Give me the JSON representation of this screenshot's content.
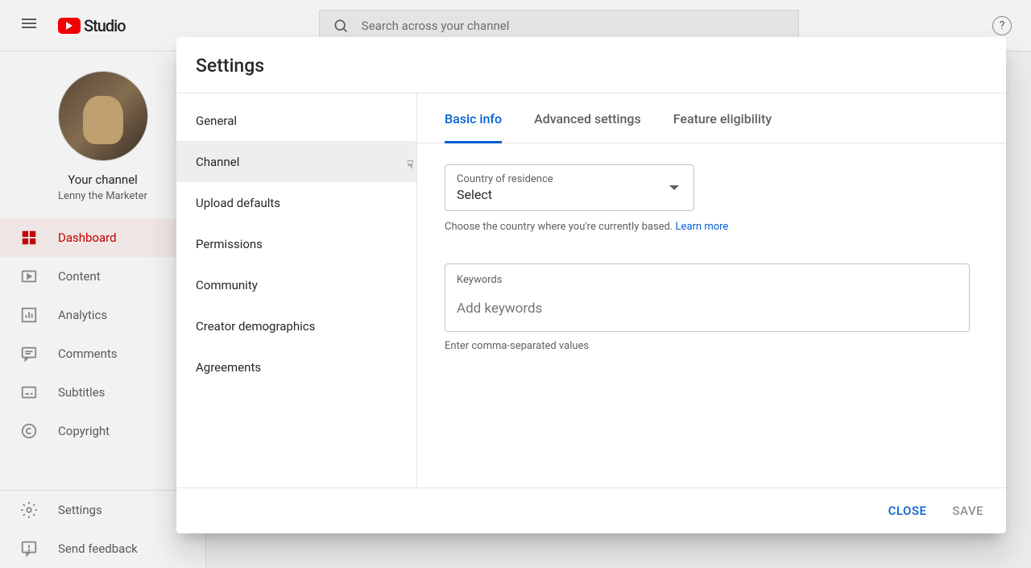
{
  "header": {
    "logo_text": "Studio",
    "search_placeholder": "Search across your channel",
    "help_label": "?"
  },
  "sidebar": {
    "your_channel": "Your channel",
    "channel_name": "Lenny the Marketer",
    "nav": [
      {
        "label": "Dashboard"
      },
      {
        "label": "Content"
      },
      {
        "label": "Analytics"
      },
      {
        "label": "Comments"
      },
      {
        "label": "Subtitles"
      },
      {
        "label": "Copyright"
      }
    ],
    "bottom": [
      {
        "label": "Settings"
      },
      {
        "label": "Send feedback"
      }
    ]
  },
  "modal": {
    "title": "Settings",
    "sidebar_items": [
      "General",
      "Channel",
      "Upload defaults",
      "Permissions",
      "Community",
      "Creator demographics",
      "Agreements"
    ],
    "tabs": [
      "Basic info",
      "Advanced settings",
      "Feature eligibility"
    ],
    "country": {
      "label": "Country of residence",
      "value": "Select",
      "helper_pre": "Choose the country where you're currently based. ",
      "learn_more": "Learn more"
    },
    "keywords": {
      "label": "Keywords",
      "placeholder": "Add keywords",
      "helper": "Enter comma-separated values"
    },
    "close": "CLOSE",
    "save": "SAVE"
  }
}
